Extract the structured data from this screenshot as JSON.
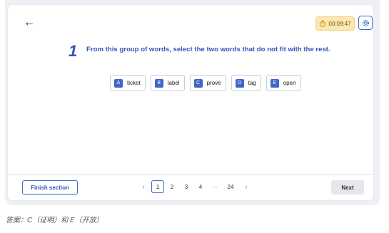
{
  "header": {
    "back_icon": "arrow-left-icon",
    "timer": "00:09:47",
    "timer_icon": "stopwatch-icon",
    "settings_icon": "gear-icon"
  },
  "question": {
    "number": "1",
    "text": "From this group of words, select the two words that do not fit with the rest."
  },
  "options": [
    {
      "letter": "A",
      "word": "ticket"
    },
    {
      "letter": "B",
      "word": "label"
    },
    {
      "letter": "C",
      "word": "prove"
    },
    {
      "letter": "D",
      "word": "tag"
    },
    {
      "letter": "E",
      "word": "open"
    }
  ],
  "footer": {
    "finish_label": "Finish section",
    "pages": [
      "1",
      "2",
      "3",
      "4",
      "···",
      "24"
    ],
    "current_page": "1",
    "prev_icon": "chevron-left-icon",
    "next_icon": "chevron-right-icon",
    "next_label": "Next"
  },
  "answer_note": "答案：C（证明）和 E（开放）",
  "colors": {
    "accent": "#3f67c7",
    "question_text": "#3455b8",
    "timer_bg": "#fbe7b4"
  }
}
